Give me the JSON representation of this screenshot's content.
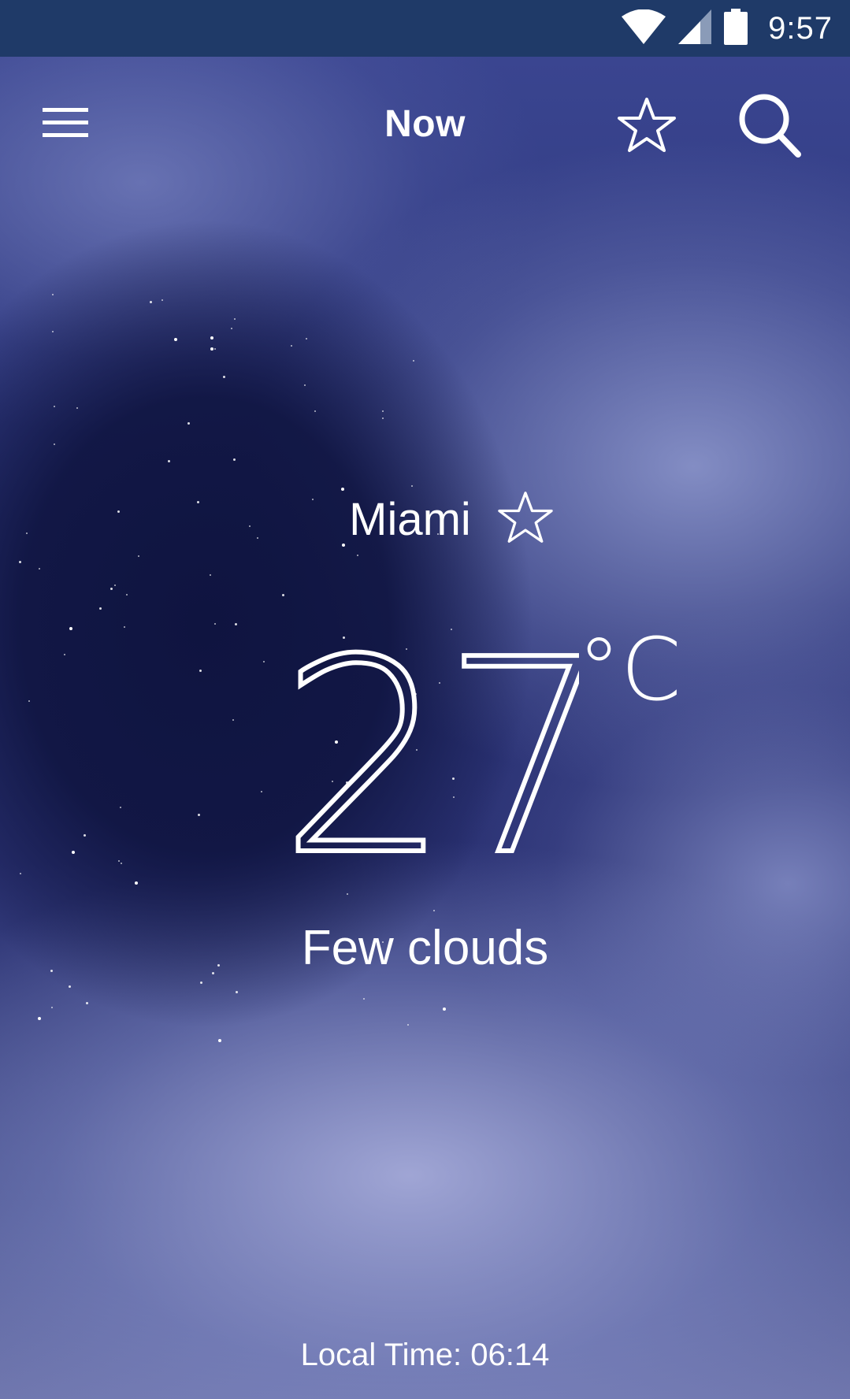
{
  "status_bar": {
    "time": "9:57",
    "icons": [
      "wifi-icon",
      "cell-signal-icon",
      "battery-icon"
    ]
  },
  "app_bar": {
    "title": "Now",
    "menu_icon": "hamburger-menu-icon",
    "favorites_icon": "star-outline-icon",
    "search_icon": "search-icon"
  },
  "weather": {
    "city": "Miami",
    "temperature": "27",
    "unit": "°C",
    "condition": "Few clouds",
    "local_time": "Local Time: 06:14"
  },
  "colors": {
    "status_bar_bg": "#1f3a68",
    "text": "#ffffff"
  }
}
